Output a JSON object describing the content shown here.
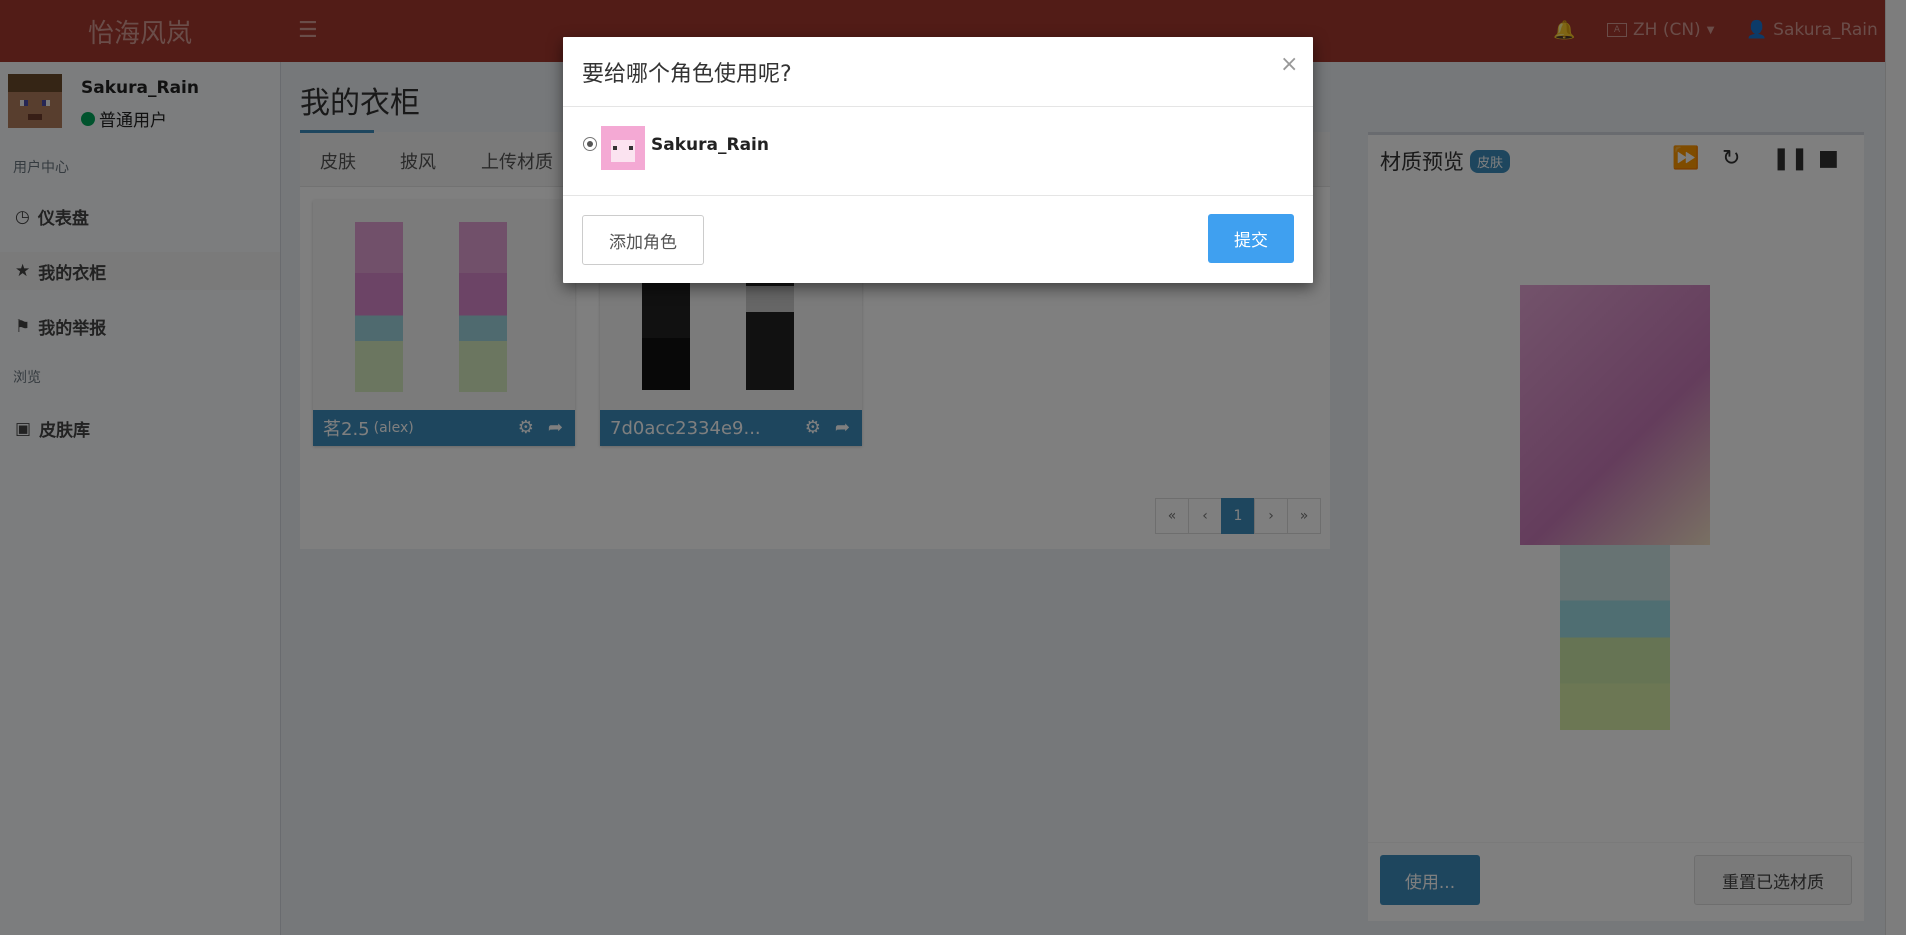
{
  "header": {
    "brand": "怡海风岚",
    "language": "ZH (CN)",
    "username": "Sakura_Rain"
  },
  "sidebar": {
    "user": {
      "name": "Sakura_Rain",
      "role": "普通用户"
    },
    "section_user": "用户中心",
    "items": [
      {
        "label": "仪表盘",
        "icon": "dashboard-icon"
      },
      {
        "label": "我的衣柜",
        "icon": "star-icon"
      },
      {
        "label": "我的举报",
        "icon": "flag-icon"
      }
    ],
    "section_browse": "浏览",
    "browse_items": [
      {
        "label": "皮肤库",
        "icon": "archive-icon"
      }
    ]
  },
  "main": {
    "title": "我的衣柜",
    "tabs": [
      "皮肤",
      "披风",
      "上传材质"
    ],
    "cards": [
      {
        "name": "茗2.5",
        "model": "(alex)"
      },
      {
        "name": "7d0acc2334e9..."
      }
    ],
    "pagination": [
      "«",
      "‹",
      "1",
      "›",
      "»"
    ]
  },
  "preview": {
    "title": "材质预览",
    "badge": "皮肤",
    "use_button": "使用...",
    "reset_button": "重置已选材质"
  },
  "modal": {
    "title": "要给哪个角色使用呢?",
    "close": "×",
    "character": "Sakura_Rain",
    "add_button": "添加角色",
    "submit_button": "提交"
  },
  "colors": {
    "header": "#a4392f",
    "primary": "#3c8dbc",
    "submit": "#3fa0f0"
  }
}
